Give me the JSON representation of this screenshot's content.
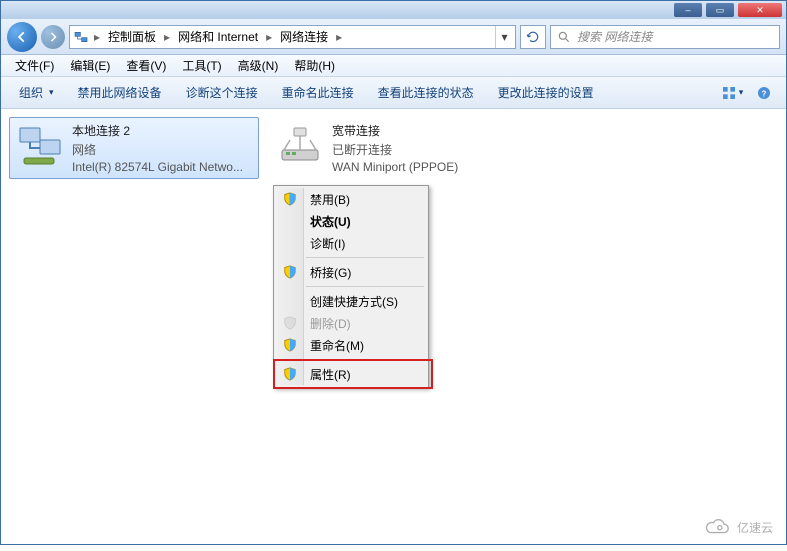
{
  "titlebar": {
    "min": "–",
    "max": "▭",
    "close": "✕"
  },
  "breadcrumbs": {
    "root_sep": "▸",
    "cp": "控制面板",
    "net": "网络和 Internet",
    "conn": "网络连接",
    "sep": "▸"
  },
  "addr_dropdown": "▾",
  "search": {
    "placeholder": "搜索 网络连接"
  },
  "menubar": {
    "file": "文件(F)",
    "edit": "编辑(E)",
    "view": "查看(V)",
    "tools": "工具(T)",
    "advanced": "高级(N)",
    "help": "帮助(H)"
  },
  "toolbar": {
    "organize": "组织",
    "disable": "禁用此网络设备",
    "diagnose": "诊断这个连接",
    "rename": "重命名此连接",
    "status": "查看此连接的状态",
    "change": "更改此连接的设置"
  },
  "connections": [
    {
      "name": "本地连接 2",
      "sub1": "网络",
      "sub2": "Intel(R) 82574L Gigabit Netwo..."
    },
    {
      "name": "宽带连接",
      "sub1": "已断开连接",
      "sub2": "WAN Miniport (PPPOE)"
    }
  ],
  "context_menu": {
    "disable": "禁用(B)",
    "status": "状态(U)",
    "diagnose": "诊断(I)",
    "bridge": "桥接(G)",
    "shortcut": "创建快捷方式(S)",
    "delete": "删除(D)",
    "rename": "重命名(M)",
    "properties": "属性(R)"
  },
  "watermark": "亿速云"
}
